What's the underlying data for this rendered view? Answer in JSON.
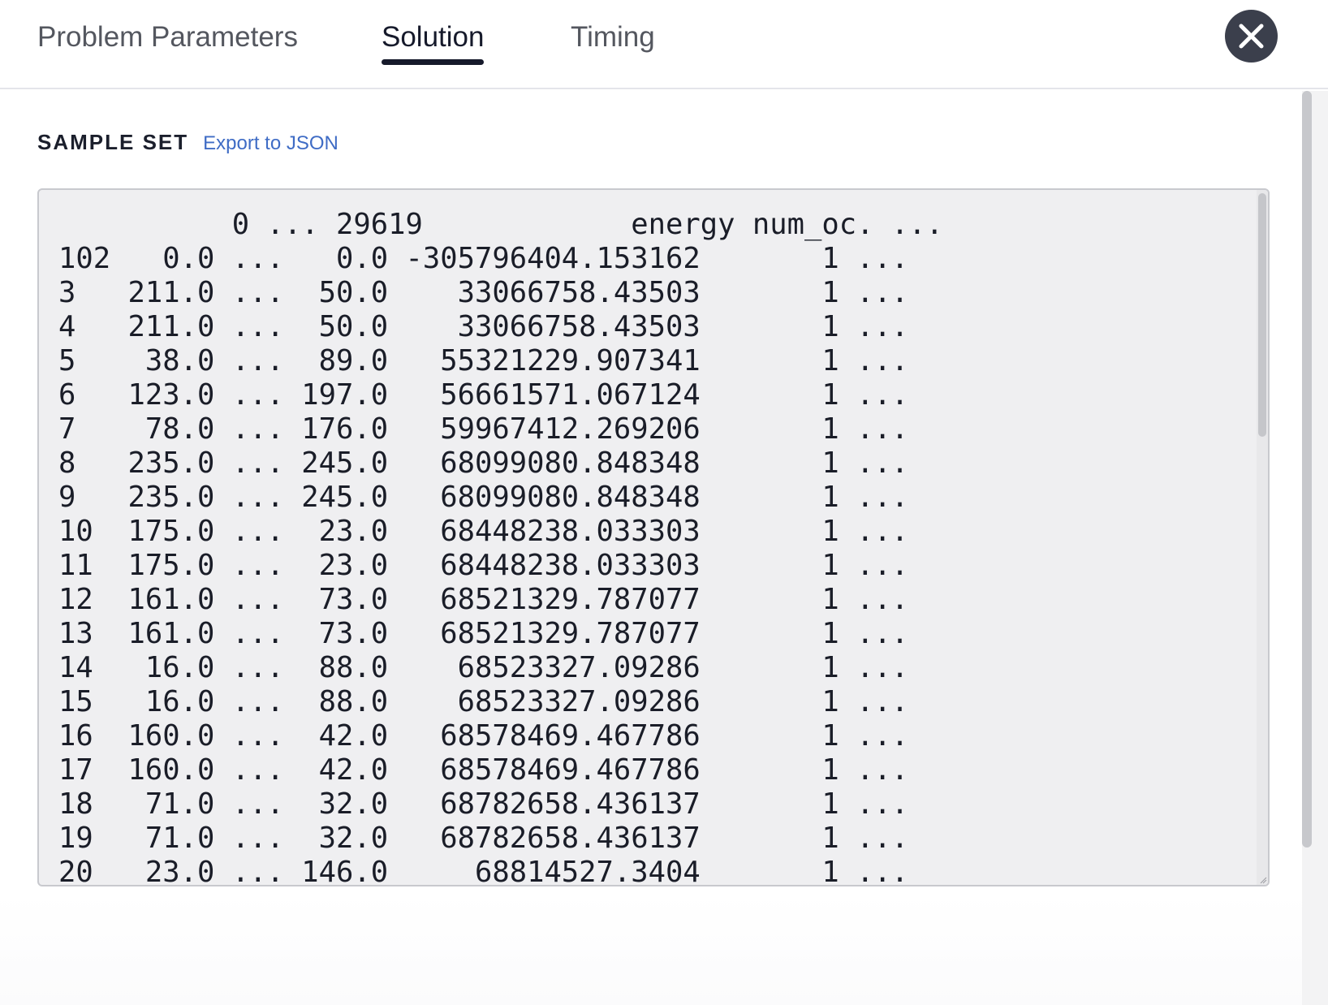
{
  "tabs": {
    "problem_parameters": "Problem Parameters",
    "solution": "Solution",
    "timing": "Timing"
  },
  "section": {
    "title": "SAMPLE SET",
    "export_link": "Export to JSON"
  },
  "sample_set_text": "          0 ... 29619            energy num_oc. ...\n102   0.0 ...   0.0 -305796404.153162       1 ...\n3   211.0 ...  50.0    33066758.43503       1 ...\n4   211.0 ...  50.0    33066758.43503       1 ...\n5    38.0 ...  89.0   55321229.907341       1 ...\n6   123.0 ... 197.0   56661571.067124       1 ...\n7    78.0 ... 176.0   59967412.269206       1 ...\n8   235.0 ... 245.0   68099080.848348       1 ...\n9   235.0 ... 245.0   68099080.848348       1 ...\n10  175.0 ...  23.0   68448238.033303       1 ...\n11  175.0 ...  23.0   68448238.033303       1 ...\n12  161.0 ...  73.0   68521329.787077       1 ...\n13  161.0 ...  73.0   68521329.787077       1 ...\n14   16.0 ...  88.0    68523327.09286       1 ...\n15   16.0 ...  88.0    68523327.09286       1 ...\n16  160.0 ...  42.0   68578469.467786       1 ...\n17  160.0 ...  42.0   68578469.467786       1 ...\n18   71.0 ...  32.0   68782658.436137       1 ...\n19   71.0 ...  32.0   68782658.436137       1 ...\n20   23.0 ... 146.0     68814527.3404       1 ...",
  "colors": {
    "active_tab": "#161a2b",
    "link": "#3f6cc5",
    "close_button": "#3b3f4c",
    "sample_background": "#efeff1"
  },
  "icons": {
    "close": "close-icon"
  }
}
